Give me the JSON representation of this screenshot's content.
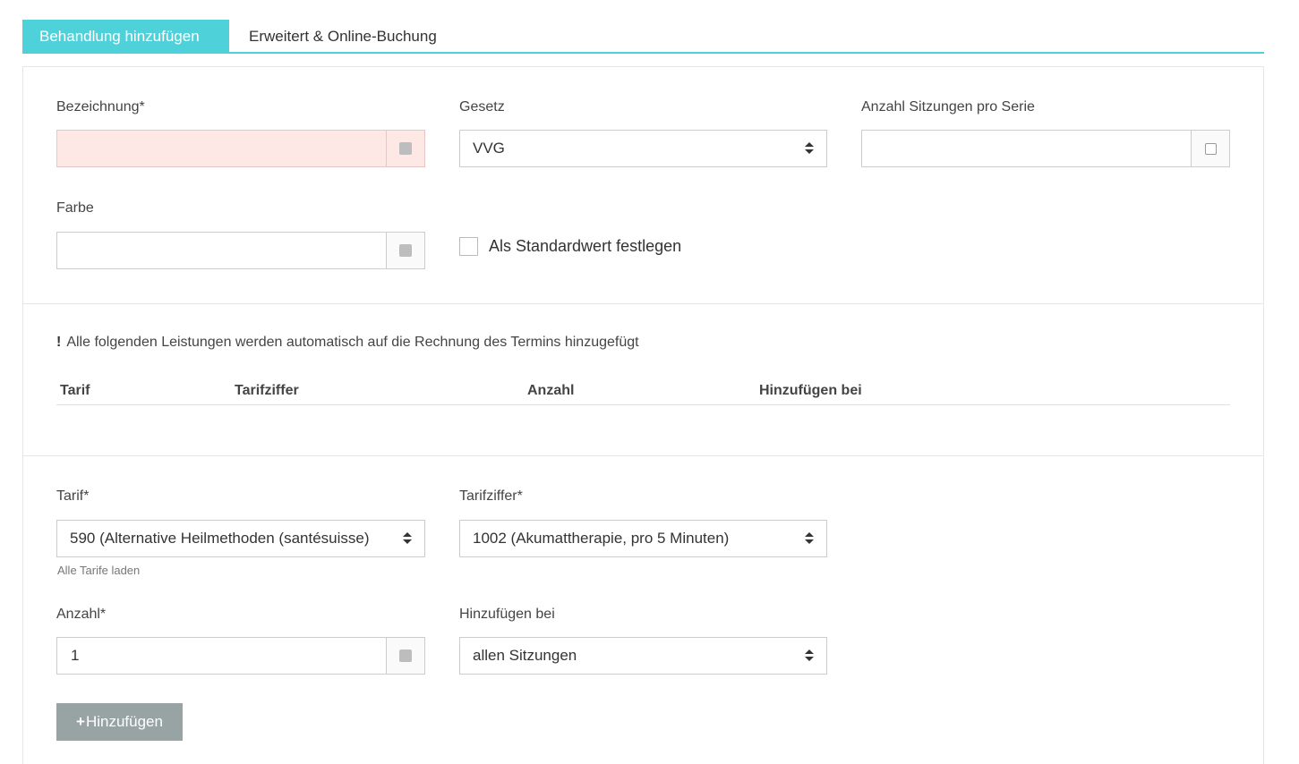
{
  "tabs": [
    {
      "label": "Behandlung hinzufügen",
      "active": true
    },
    {
      "label": "Erweitert & Online-Buchung",
      "active": false
    }
  ],
  "form": {
    "bezeichnung_label": "Bezeichnung*",
    "bezeichnung_value": "",
    "gesetz_label": "Gesetz",
    "gesetz_value": "VVG",
    "sitzungen_label": "Anzahl Sitzungen pro Serie",
    "sitzungen_value": "",
    "farbe_label": "Farbe",
    "farbe_value": "",
    "standard_label": "Als Standardwert festlegen",
    "standard_checked": false
  },
  "services": {
    "notice_icon": "!",
    "notice": "Alle folgenden Leistungen werden automatisch auf die Rechnung des Termins hinzugefügt",
    "columns": [
      "Tarif",
      "Tarifziffer",
      "Anzahl",
      "Hinzufügen bei"
    ],
    "rows": []
  },
  "add": {
    "tarif_label": "Tarif*",
    "tarif_value": "590 (Alternative Heilmethoden (santésuisse)",
    "tarif_link": "Alle Tarife laden",
    "tarifziffer_label": "Tarifziffer*",
    "tarifziffer_value": "1002 (Akumattherapie, pro 5 Minuten)",
    "anzahl_label": "Anzahl*",
    "anzahl_value": "1",
    "hinzufuegen_label": "Hinzufügen bei",
    "hinzufuegen_value": "allen Sitzungen",
    "button_icon": "+",
    "button_label": "Hinzufügen"
  },
  "colors": {
    "accent": "#4fd1d9",
    "error_bg": "#fde8e6",
    "button_bg": "#98a3a3"
  }
}
